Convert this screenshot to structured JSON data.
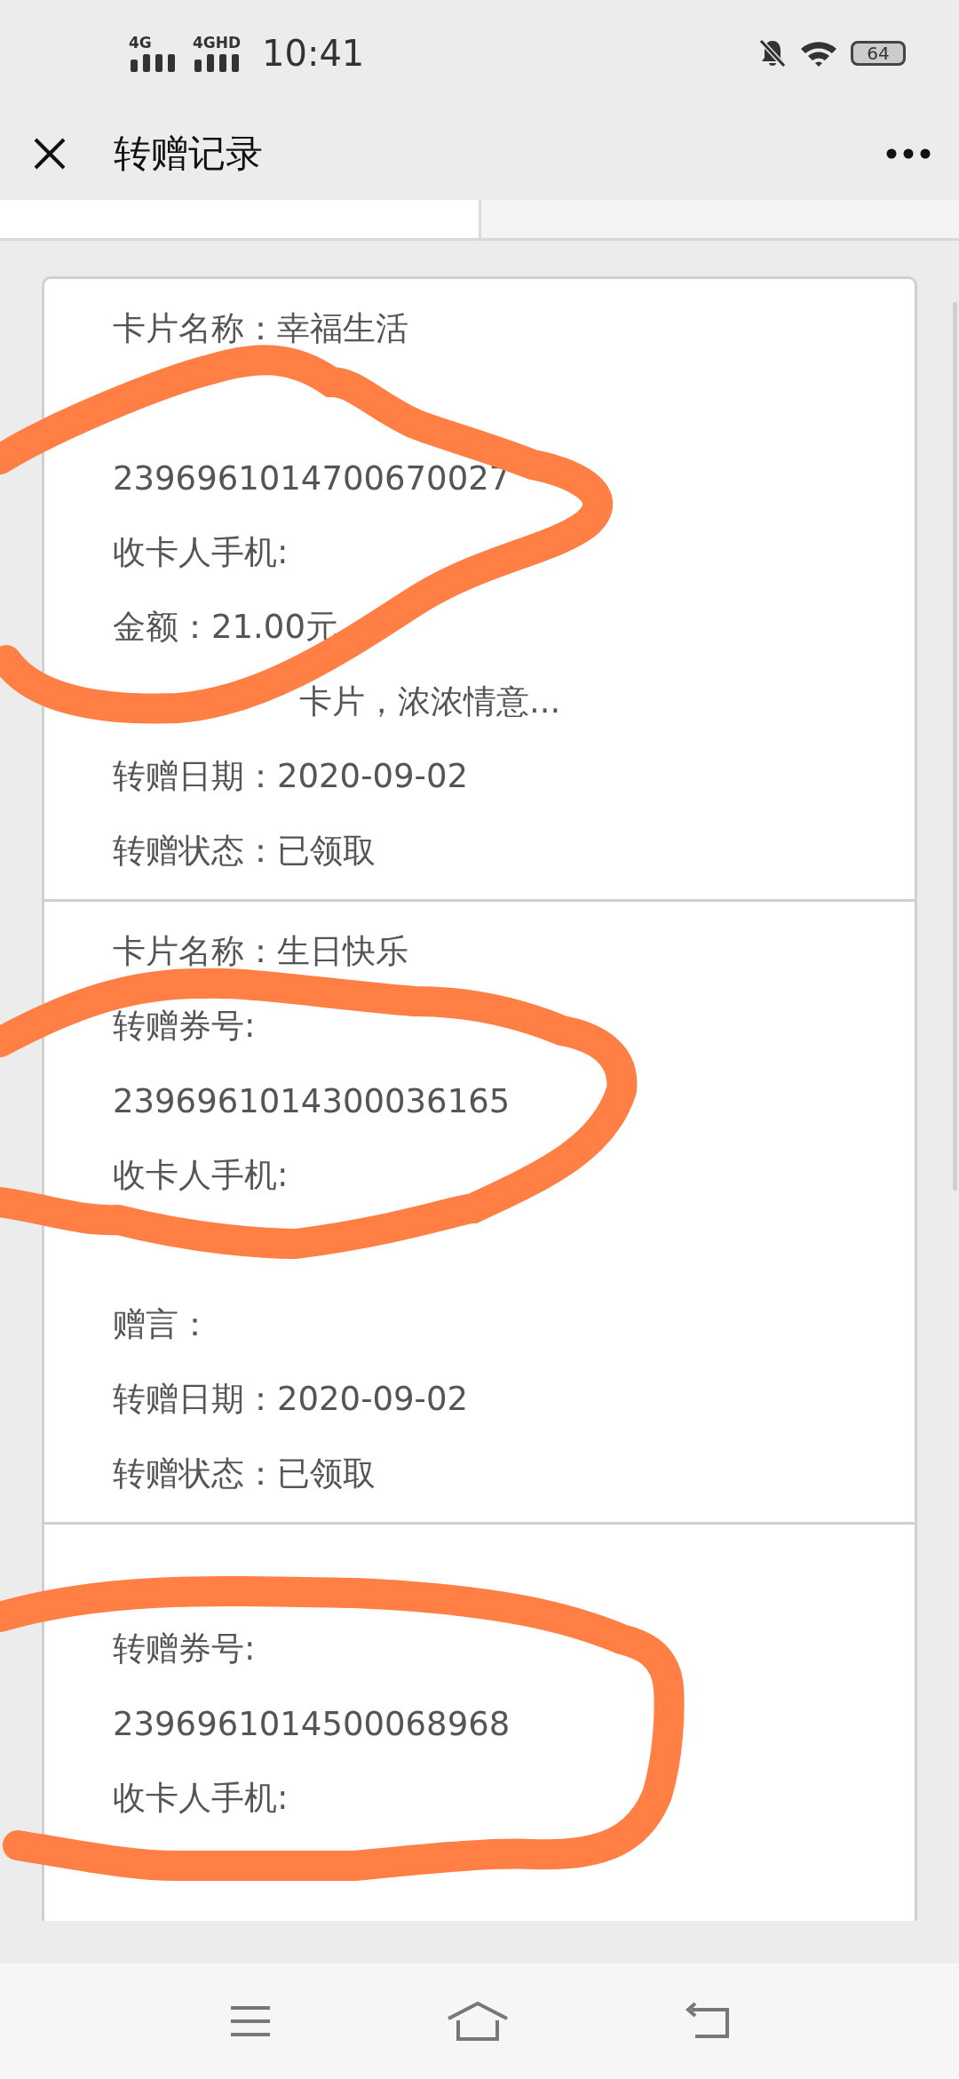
{
  "status_bar": {
    "sim1": "4G",
    "sim2": "4GHD",
    "time": "10:41",
    "battery": "64"
  },
  "header": {
    "title": "转赠记录"
  },
  "tabs": [
    {
      "selected": true
    },
    {
      "selected": false
    }
  ],
  "cards": [
    {
      "rows": [
        {
          "kind": "line",
          "text": "卡片名称：幸福生活"
        },
        {
          "kind": "covered"
        },
        {
          "kind": "line",
          "text": "2396961014700670027"
        },
        {
          "kind": "line",
          "text": "收卡人手机:"
        },
        {
          "kind": "line",
          "text": "金额：21.00元"
        },
        {
          "kind": "offset",
          "text": "卡片，浓浓情意..."
        },
        {
          "kind": "line",
          "text": "转赠日期：2020-09-02"
        },
        {
          "kind": "line",
          "text": "转赠状态：已领取"
        }
      ]
    },
    {
      "rows": [
        {
          "kind": "line",
          "text": "卡片名称：生日快乐"
        },
        {
          "kind": "line",
          "text": "转赠券号:"
        },
        {
          "kind": "line",
          "text": "2396961014300036165"
        },
        {
          "kind": "line",
          "text": "收卡人手机:"
        },
        {
          "kind": "covered"
        },
        {
          "kind": "line",
          "text": "赠言："
        },
        {
          "kind": "line",
          "text": "转赠日期：2020-09-02"
        },
        {
          "kind": "line",
          "text": "转赠状态：已领取"
        }
      ]
    },
    {
      "rows": [
        {
          "kind": "covered"
        },
        {
          "kind": "line",
          "text": "转赠券号:"
        },
        {
          "kind": "line",
          "text": "2396961014500068968"
        },
        {
          "kind": "line",
          "text": "收卡人手机:"
        },
        {
          "kind": "covered"
        }
      ]
    }
  ]
}
